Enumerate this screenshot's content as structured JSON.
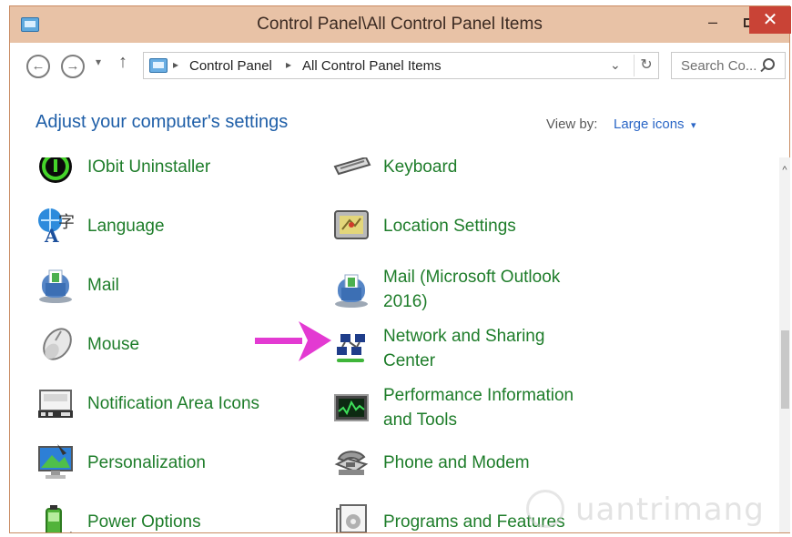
{
  "window": {
    "title": "Control Panel\\All Control Panel Items",
    "minimize_glyph": "–",
    "close_glyph": "✕"
  },
  "toolbar": {
    "back_glyph": "←",
    "forward_glyph": "→",
    "recent_glyph": "▾",
    "up_glyph": "↑",
    "breadcrumb": [
      "Control Panel",
      "All Control Panel Items"
    ],
    "separator_glyph": "▸",
    "address_dropdown_glyph": "⌄",
    "refresh_glyph": "↻",
    "search_placeholder": "Search Co..."
  },
  "header": {
    "heading": "Adjust your computer's settings",
    "view_by_label": "View by:",
    "view_by_value": "Large icons",
    "view_by_caret": "▾"
  },
  "items_left": [
    {
      "label_lines": [
        "IObit Uninstaller"
      ],
      "icon": "iobit-icon"
    },
    {
      "label_lines": [
        "Language"
      ],
      "icon": "language-icon"
    },
    {
      "label_lines": [
        "Mail"
      ],
      "icon": "mail-icon"
    },
    {
      "label_lines": [
        "Mouse"
      ],
      "icon": "mouse-icon"
    },
    {
      "label_lines": [
        "Notification Area Icons"
      ],
      "icon": "notification-icon"
    },
    {
      "label_lines": [
        "Personalization"
      ],
      "icon": "personalization-icon"
    },
    {
      "label_lines": [
        "Power Options"
      ],
      "icon": "power-icon"
    }
  ],
  "items_right": [
    {
      "label_lines": [
        "Keyboard"
      ],
      "icon": "keyboard-icon"
    },
    {
      "label_lines": [
        "Location Settings"
      ],
      "icon": "location-icon"
    },
    {
      "label_lines": [
        "Mail (Microsoft Outlook",
        "2016)"
      ],
      "icon": "mail-outlook-icon"
    },
    {
      "label_lines": [
        "Network and Sharing",
        "Center"
      ],
      "icon": "network-icon"
    },
    {
      "label_lines": [
        "Performance Information",
        "and Tools"
      ],
      "icon": "performance-icon"
    },
    {
      "label_lines": [
        "Phone and Modem"
      ],
      "icon": "phone-icon"
    },
    {
      "label_lines": [
        "Programs and Features"
      ],
      "icon": "programs-icon"
    }
  ],
  "scrollbar": {
    "up_glyph": "^"
  },
  "watermark": {
    "text": "uantrimang"
  },
  "colors": {
    "titlebar": "#e8c2a6",
    "link_green": "#1e7d2a",
    "heading_blue": "#1f5fa8",
    "arrow_magenta": "#e33ad2",
    "close_red": "#c94336"
  }
}
